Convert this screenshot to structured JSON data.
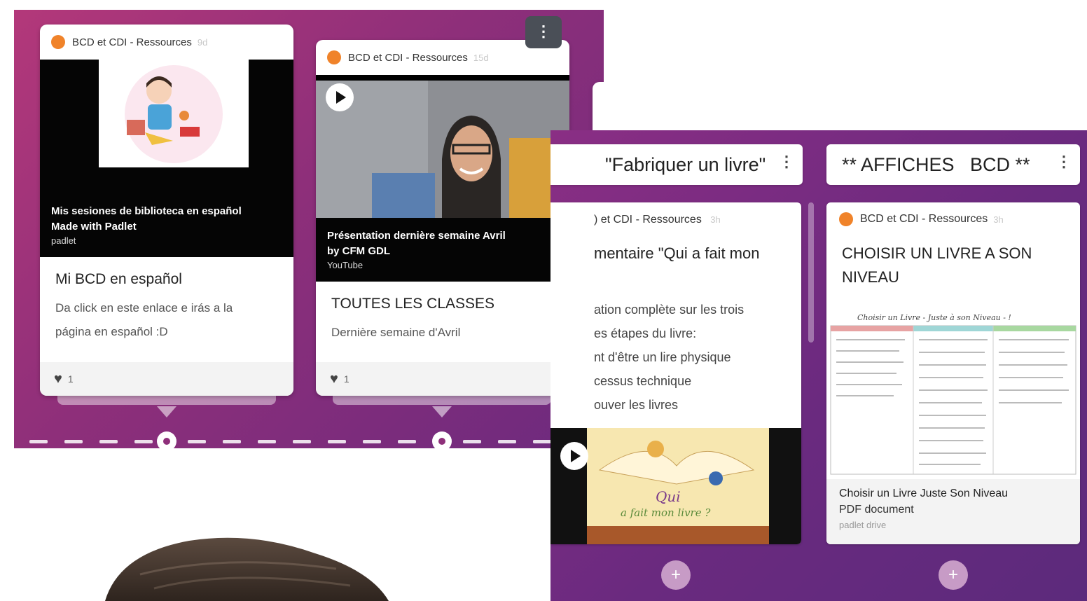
{
  "timeline": {
    "cards": [
      {
        "author": "BCD et CDI - Ressources",
        "age": "9d",
        "media_title": "Mis sesiones de biblioteca en español",
        "media_subtitle": "Made with Padlet",
        "media_source": "padlet",
        "title": "Mi BCD en español",
        "body_lines": [
          "Da click en este enlace e irás a la",
          "página en español :D"
        ],
        "likes": "1"
      },
      {
        "author": "BCD et CDI - Ressources",
        "age": "15d",
        "media_title": "Présentation dernière semaine Avril",
        "media_subtitle": "by CFM GDL",
        "media_source": "YouTube",
        "title": "TOUTES LES CLASSES",
        "body": "Dernière semaine d'Avril",
        "likes": "1"
      }
    ],
    "menu_icon": "kebab-icon"
  },
  "columns": [
    {
      "header": "\"Fabriquer un livre\"",
      "post": {
        "author": ") et CDI - Ressources",
        "age": "3h",
        "title": "mentaire \"Qui a fait mon",
        "body_lines": [
          "ation complète sur les trois",
          "es étapes du livre:",
          "nt d'être un lire physique",
          "cessus technique",
          "ouver les livres"
        ],
        "image_caption_line1": "Qui",
        "image_caption_line2": "a fait mon livre ?"
      }
    },
    {
      "header": "** AFFICHES   BCD **",
      "post": {
        "author": "BCD et CDI - Ressources",
        "age": "3h",
        "title_line1": "CHOISIR UN LIVRE A SON",
        "title_line2": "NIVEAU",
        "doc_heading": "Choisir un Livre - Juste à son Niveau - !",
        "attachment_title": "Choisir un Livre Juste Son Niveau",
        "attachment_type": "PDF document",
        "attachment_source": "padlet drive"
      }
    }
  ],
  "add_label": "+",
  "colors": {
    "accent_orange": "#f0832a",
    "panel_magenta": "#a3357c",
    "panel_purple": "#6a2a7f"
  }
}
